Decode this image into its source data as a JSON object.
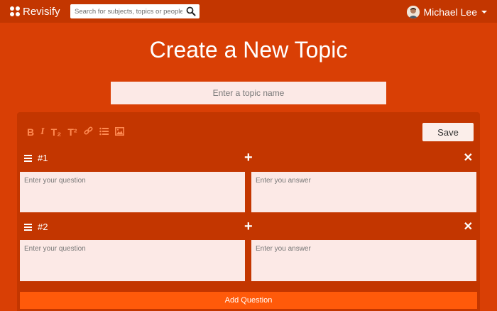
{
  "header": {
    "brand": "Revisify",
    "search_placeholder": "Search for subjects, topics or people",
    "user_name": "Michael Lee"
  },
  "main": {
    "title": "Create a New Topic",
    "topic_placeholder": "Enter a topic name"
  },
  "editor": {
    "toolbar": [
      {
        "icon": "bold-icon",
        "glyph": "B"
      },
      {
        "icon": "italic-icon",
        "glyph": "I"
      },
      {
        "icon": "subscript-icon",
        "glyph": "T₂"
      },
      {
        "icon": "superscript-icon",
        "glyph": "T²"
      },
      {
        "icon": "link-icon",
        "glyph": "🔗"
      },
      {
        "icon": "list-icon",
        "glyph": "☰"
      },
      {
        "icon": "image-icon",
        "glyph": "▣"
      }
    ],
    "save_label": "Save",
    "questions": [
      {
        "number": "#1",
        "question_placeholder": "Enter your question",
        "answer_placeholder": "Enter you answer"
      },
      {
        "number": "#2",
        "question_placeholder": "Enter your question",
        "answer_placeholder": "Enter you answer"
      }
    ],
    "add_question_label": "Add Question"
  },
  "colors": {
    "background": "#d93f05",
    "header": "#c33600",
    "toolbar_icon": "#ff8a52",
    "add_button": "#ff5a0a",
    "field": "#fce9e6"
  }
}
